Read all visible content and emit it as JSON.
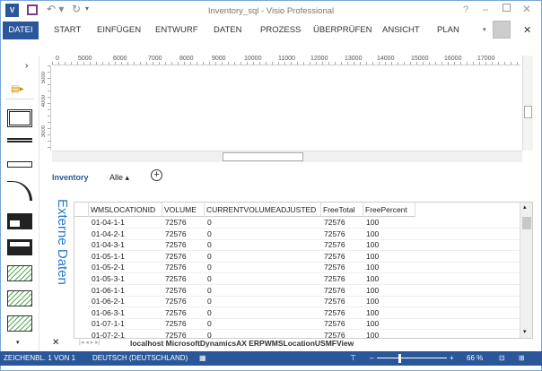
{
  "app": {
    "title": "Inventory_sql - Visio Professional"
  },
  "ribbon": {
    "tabs": [
      "DATEI",
      "START",
      "EINFÜGEN",
      "ENTWURF",
      "DATEN",
      "PROZESS",
      "ÜBERPRÜFEN",
      "ANSICHT",
      "PLAN"
    ]
  },
  "ruler": {
    "h_ticks": [
      "0",
      "5000",
      "6000",
      "7000",
      "8000",
      "9000",
      "10000",
      "11000",
      "12000",
      "13000",
      "14000",
      "15000",
      "16000",
      "17000"
    ],
    "v_ticks": [
      "5000",
      "4000",
      "3000"
    ]
  },
  "page_tabs": {
    "active": "Inventory",
    "all": "Alle"
  },
  "external_data": {
    "label": "Externe Daten",
    "columns": [
      "WMSLOCATIONID",
      "VOLUME",
      "CURRENTVOLUMEADJUSTED",
      "FreeTotal",
      "FreePercent"
    ],
    "rows": [
      [
        "01-04-1-1",
        "72576",
        "0",
        "72576",
        "100"
      ],
      [
        "01-04-2-1",
        "72576",
        "0",
        "72576",
        "100"
      ],
      [
        "01-04-3-1",
        "72576",
        "0",
        "72576",
        "100"
      ],
      [
        "01-05-1-1",
        "72576",
        "0",
        "72576",
        "100"
      ],
      [
        "01-05-2-1",
        "72576",
        "0",
        "72576",
        "100"
      ],
      [
        "01-05-3-1",
        "72576",
        "0",
        "72576",
        "100"
      ],
      [
        "01-06-1-1",
        "72576",
        "0",
        "72576",
        "100"
      ],
      [
        "01-06-2-1",
        "72576",
        "0",
        "72576",
        "100"
      ],
      [
        "01-06-3-1",
        "72576",
        "0",
        "72576",
        "100"
      ],
      [
        "01-07-1-1",
        "72576",
        "0",
        "72576",
        "100"
      ],
      [
        "01-07-2-1",
        "72576",
        "0",
        "72576",
        "100"
      ]
    ],
    "source": "localhost MicrosoftDynamicsAX ERPWMSLocationUSMFView"
  },
  "status": {
    "page": "ZEICHENBL. 1 VON 1",
    "language": "DEUTSCH (DEUTSCHLAND)",
    "zoom": "66 %",
    "zoom_percent": 66
  },
  "colors": {
    "accent": "#2b579a",
    "external_label": "#2b79d0"
  }
}
